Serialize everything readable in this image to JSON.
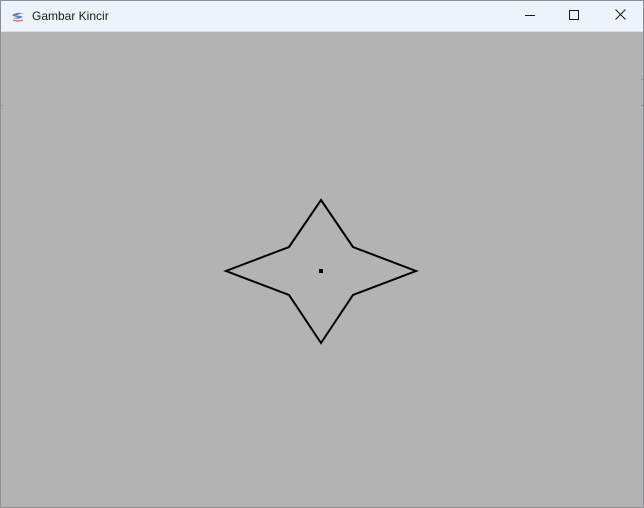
{
  "window": {
    "title": "Gambar Kincir",
    "icon": "java-cup-icon"
  },
  "caption_buttons": {
    "minimize": "minimize-icon",
    "maximize": "maximize-icon",
    "close": "close-icon"
  },
  "canvas": {
    "background": "#b3b3b3",
    "stroke_color": "#000000",
    "shape": "four-point-star",
    "center_marker": "dot"
  }
}
